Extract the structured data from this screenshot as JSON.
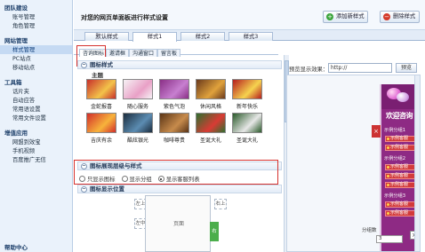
{
  "sidebar": {
    "sections": [
      {
        "title": "团队建设",
        "items": [
          "账号管理",
          "角色管理"
        ]
      },
      {
        "title": "网站管理",
        "items": [
          "样式管理",
          "PC站点",
          "移动站点"
        ]
      },
      {
        "title": "工具箱",
        "items": [
          "话片夹",
          "自动应答",
          "常用语设置",
          "常用文件设置"
        ]
      },
      {
        "title": "增值应用",
        "items": [
          "网盟到效宝",
          "手机视频",
          "百度推广无信"
        ]
      },
      {
        "title": "帮助中心",
        "items": []
      }
    ],
    "active": "样式管理"
  },
  "header": {
    "title": "对您的网页单面板进行样式设置",
    "add_style": "添加新样式",
    "delete_style": "删除样式"
  },
  "style_tabs": [
    "默认样式",
    "样式1",
    "样式2",
    "样式3"
  ],
  "active_style_tab": "样式1",
  "sub_tabs": [
    "咨询图标",
    "邀请框",
    "沟通窗口",
    "留言板"
  ],
  "active_sub_tab": "咨询图标",
  "icon_style_section": {
    "title": "图标样式",
    "theme_label": "主题",
    "themes": [
      {
        "name": "金蛇报喜",
        "bg": "#c8302b",
        "bg2": "#f3c34a"
      },
      {
        "name": "随心服务",
        "bg": "#f6f2f5",
        "bg2": "#e9a0c6"
      },
      {
        "name": "紫色气泡",
        "bg": "#8a2f86",
        "bg2": "#c77fd0"
      },
      {
        "name": "休闲风格",
        "bg": "#6b3a1c",
        "bg2": "#e0a23c"
      },
      {
        "name": "新年快乐",
        "bg": "#b51e1e",
        "bg2": "#f6d34f"
      },
      {
        "name": "吉庆有余",
        "bg": "#d22e2a",
        "bg2": "#f7b33b"
      },
      {
        "name": "酷炫银光",
        "bg": "#1c2d3e",
        "bg2": "#5c8cb2"
      },
      {
        "name": "咖啡尊贵",
        "bg": "#5a3416",
        "bg2": "#c78b4c"
      },
      {
        "name": "圣诞大礼",
        "bg": "#2f6f2f",
        "bg2": "#d93b34"
      },
      {
        "name": "圣诞大礼",
        "bg": "#2a5a2a",
        "bg2": "#e7e7e7"
      }
    ]
  },
  "display_section": {
    "title": "图标展现层级与样式",
    "options": [
      "只显示图标",
      "显示分组",
      "显示客服列表"
    ],
    "selected": "显示客服列表"
  },
  "position_section": {
    "title": "图标显示位置",
    "labels": {
      "top_left": "左上",
      "middle_left": "左中",
      "page": "页面",
      "top_right": "右上",
      "middle_right": "右中"
    }
  },
  "preview": {
    "url_label": "预览显示效果：",
    "url_value": "http://",
    "button": "预览",
    "widget_title": "欢迎咨询",
    "groups": [
      "示例分组1",
      "示例分组2",
      "示例分组3"
    ],
    "service": "示例客服",
    "group_label": "分组数",
    "group_count": "3"
  },
  "colors": {
    "accent_purple": "#8e2a84",
    "highlight_red": "#d6322e",
    "sidebar_bg": "#eaf2fb"
  }
}
